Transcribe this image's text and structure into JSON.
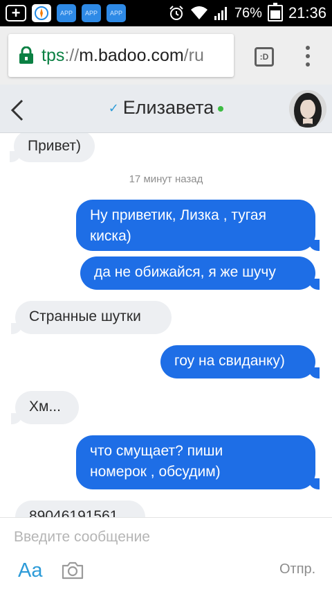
{
  "status_bar": {
    "battery": "76%",
    "time": "21:36",
    "app_icon_label": "APP"
  },
  "browser": {
    "url_scheme": "tps",
    "url_separator": "://",
    "url_host": "m.badoo.com",
    "url_path": "/ru",
    "tabs_label": ":D"
  },
  "chat": {
    "contact_name": "Елизавета",
    "timestamp": "17 минут назад"
  },
  "messages": [
    {
      "direction": "in",
      "text": "Привет)"
    },
    {
      "direction": "out",
      "lines": [
        "Ну приветик, Лизка , тугая",
        "киска)"
      ]
    },
    {
      "direction": "out",
      "text": "да не обижайся, я же шучу"
    },
    {
      "direction": "in",
      "text": "Странные шутки"
    },
    {
      "direction": "out",
      "text": "гоу на свиданку)"
    },
    {
      "direction": "in",
      "text": "Хм..."
    },
    {
      "direction": "out",
      "lines": [
        "что смущает? пиши",
        "номерок , обсудим)"
      ]
    },
    {
      "direction": "in",
      "text": "89046191561"
    }
  ],
  "composer": {
    "placeholder": "Введите сообщение",
    "font_button": "Aa",
    "send_label": "Отпр."
  },
  "colors": {
    "outgoing_bubble": "#1e6ee6",
    "incoming_bubble": "#edeff2",
    "accent": "#2d9bd8",
    "online": "#3dbb43",
    "secure_scheme": "#0b8043"
  }
}
